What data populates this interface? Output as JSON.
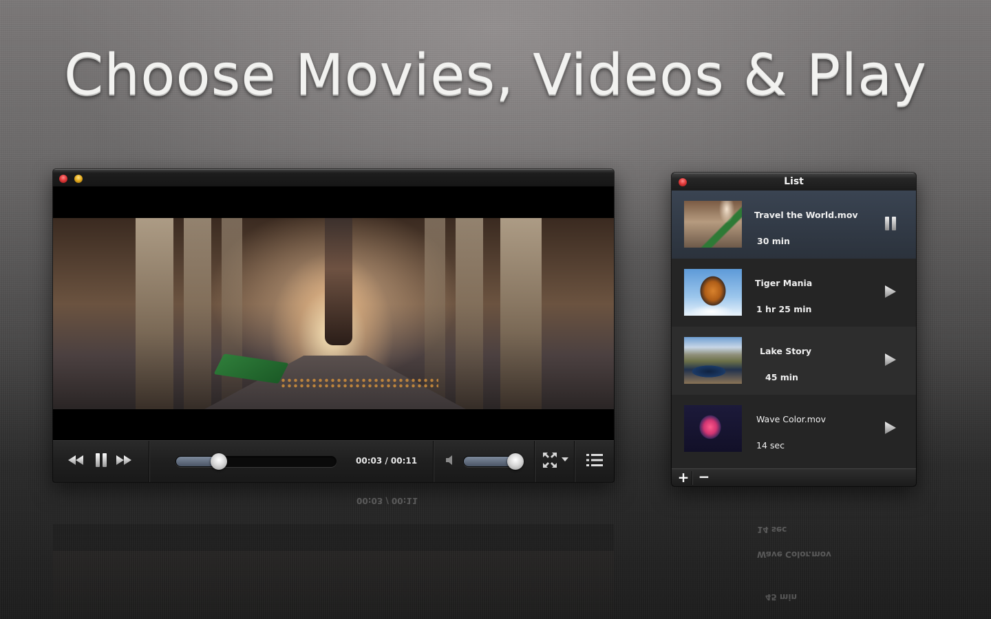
{
  "headline": "Choose Movies, Videos & Play",
  "player": {
    "window_controls": [
      "close",
      "minimize"
    ],
    "controls": {
      "rewind_icon": "rewind-icon",
      "pause_icon": "pause-icon",
      "fast_forward_icon": "fast-forward-icon",
      "seek_progress": 0.27,
      "time_current": "00:03",
      "time_total": "00:11",
      "time_display": "00:03 / 00:11",
      "volume_icon": "speaker-icon",
      "volume_level": 1.0,
      "fullscreen_icon": "fullscreen-icon",
      "fullscreen_menu_icon": "chevron-down-icon",
      "playlist_icon": "list-icon"
    },
    "colors": {
      "progress_fill": "#5b6677",
      "close": "#e23b3b",
      "minimize": "#e9b020"
    }
  },
  "list": {
    "title": "List",
    "items": [
      {
        "name": "Travel the World.mov",
        "duration": "30 min",
        "state": "playing",
        "action_icon": "pause-icon"
      },
      {
        "name": "Tiger Mania",
        "duration": "1 hr 25 min",
        "state": "idle",
        "action_icon": "play-icon"
      },
      {
        "name": "Lake Story",
        "duration": "45 min",
        "state": "idle",
        "action_icon": "play-icon"
      },
      {
        "name": "Wave Color.mov",
        "duration": "14 sec",
        "state": "idle",
        "action_icon": "play-icon"
      }
    ],
    "footer": {
      "add_label": "+",
      "remove_label": "−"
    },
    "colors": {
      "active_row": "#333c48"
    }
  }
}
